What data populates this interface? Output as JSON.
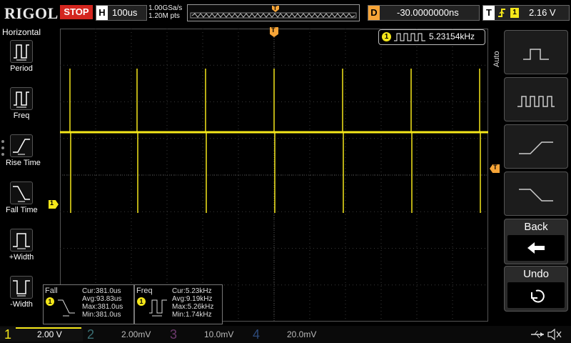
{
  "header": {
    "brand": "RIGOL",
    "run_state": "STOP",
    "timebase_label": "H",
    "timebase_value": "100us",
    "sample_rate": "1.00GSa/s",
    "memory_depth": "1.20M pts",
    "trigger_marker": "T",
    "delay_label": "D",
    "delay_value": "-30.0000000ns",
    "trigger_label": "T",
    "trigger_channel": "1",
    "trigger_level": "2.16 V"
  },
  "left_menu": {
    "title": "Horizontal",
    "items": [
      {
        "label": "Period",
        "icon": "period-icon"
      },
      {
        "label": "Freq",
        "icon": "freq-icon"
      },
      {
        "label": "Rise Time",
        "icon": "rise-time-icon"
      },
      {
        "label": "Fall Time",
        "icon": "fall-time-icon"
      },
      {
        "label": "+Width",
        "icon": "pos-width-icon"
      },
      {
        "label": "-Width",
        "icon": "neg-width-icon"
      }
    ]
  },
  "freq_counter": {
    "channel": "1",
    "value": "5.23154kHz"
  },
  "right_menu": {
    "mode": "Auto",
    "buttons": [
      {
        "name": "single-pulse-button",
        "icon": "single-pulse-icon"
      },
      {
        "name": "pulse-train-button",
        "icon": "pulse-train-icon"
      },
      {
        "name": "rising-edge-button",
        "icon": "rising-edge-icon"
      },
      {
        "name": "falling-edge-button",
        "icon": "falling-edge-icon"
      }
    ],
    "back_label": "Back",
    "undo_label": "Undo"
  },
  "markers": {
    "channel1_ground": "1",
    "trigger_position": "T",
    "trigger_level_arrow": "T"
  },
  "measurements": [
    {
      "title": "Fall",
      "channel": "1",
      "cur": "Cur:381.0us",
      "avg": "Avg:93.83us",
      "max": "Max:381.0us",
      "min": "Min:381.0us"
    },
    {
      "title": "Freq",
      "channel": "1",
      "cur": "Cur:5.23kHz",
      "avg": "Avg:9.19kHz",
      "max": "Max:5.26kHz",
      "min": "Min:1.74kHz"
    }
  ],
  "channels": [
    {
      "num": "1",
      "scale": "2.00 V",
      "color": "#f5e71a"
    },
    {
      "num": "2",
      "scale": "2.00mV",
      "color": "#00d6e6"
    },
    {
      "num": "3",
      "scale": "10.0mV",
      "color": "#e040e0"
    },
    {
      "num": "4",
      "scale": "20.0mV",
      "color": "#2f7bff"
    }
  ],
  "colors": {
    "ch1": "#f5e71a",
    "trigger": "#f6a437",
    "stop": "#d4261f"
  },
  "status_icons": [
    "usb-icon",
    "mute-icon"
  ]
}
